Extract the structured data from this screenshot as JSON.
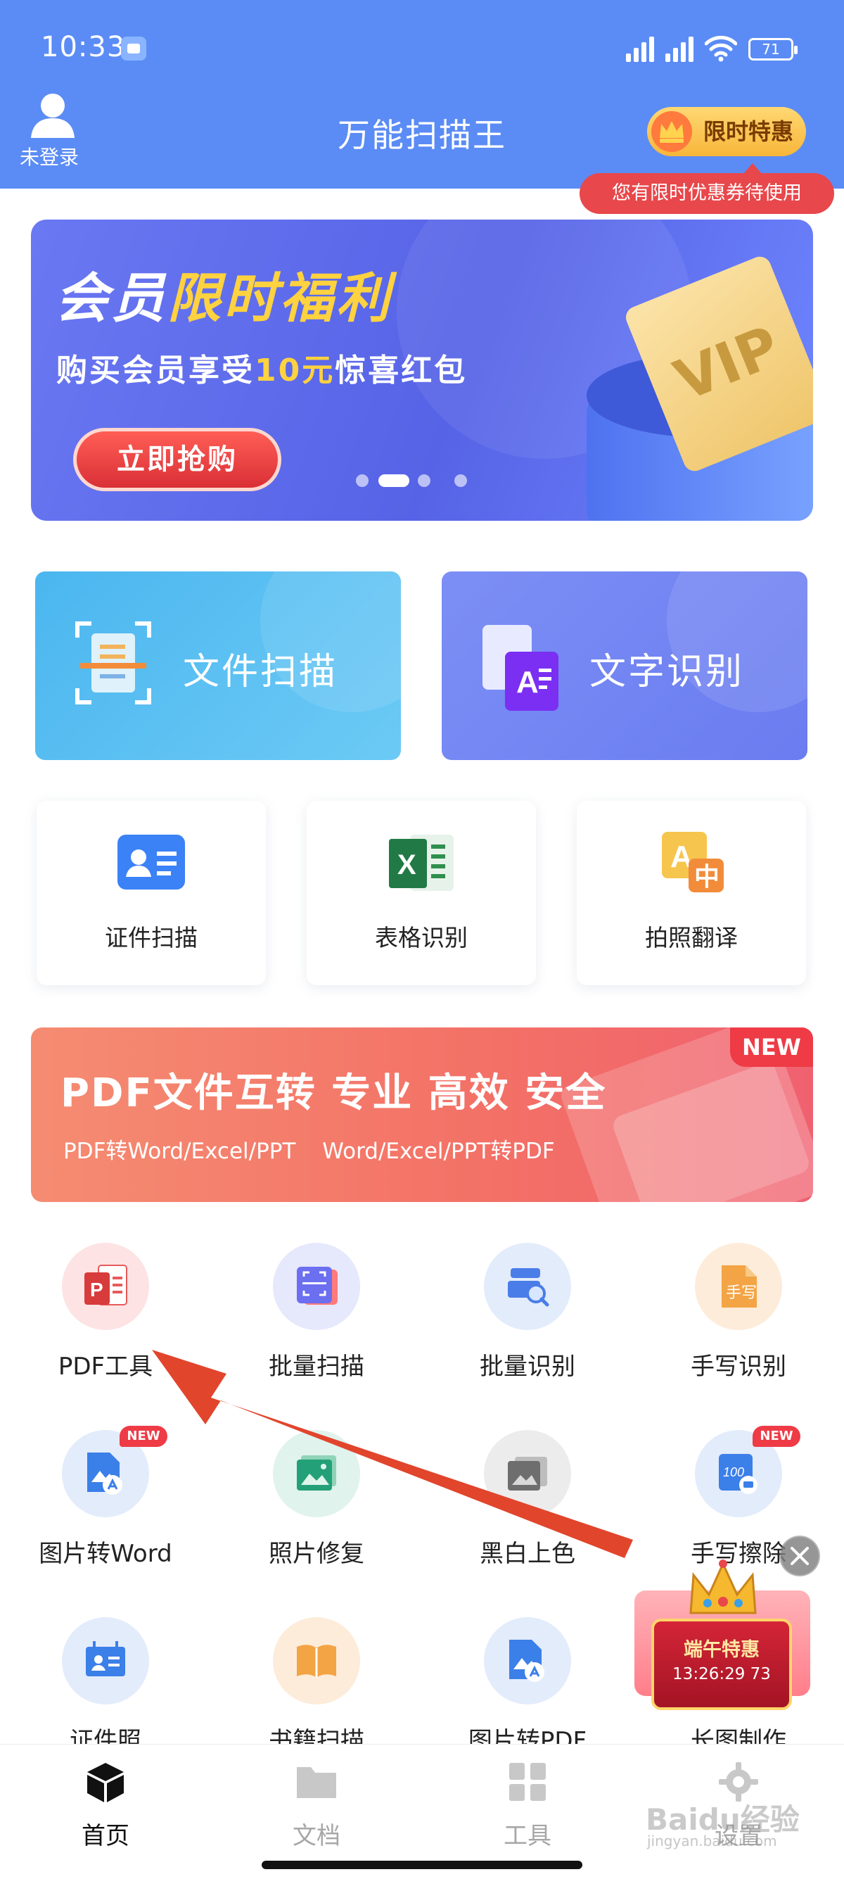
{
  "status_bar": {
    "time": "10:33",
    "battery": "71"
  },
  "header": {
    "login_label": "未登录",
    "title": "万能扫描王",
    "promo_label": "限时特惠",
    "promo_tip": "您有限时优惠券待使用"
  },
  "banner": {
    "title_prefix": "会员",
    "title_highlight": "限时福利",
    "subtitle_prefix": "购买会员享受",
    "subtitle_highlight": "10元",
    "subtitle_suffix": "惊喜红包",
    "button": "立即抢购",
    "card_text": "VIP",
    "pages": 4,
    "active_page": 2
  },
  "feature_cards": [
    {
      "label": "文件扫描",
      "icon": "document-scan-icon"
    },
    {
      "label": "文字识别",
      "icon": "text-recognition-icon"
    }
  ],
  "small_cards": [
    {
      "label": "证件扫描",
      "icon": "id-card-icon"
    },
    {
      "label": "表格识别",
      "icon": "excel-icon"
    },
    {
      "label": "拍照翻译",
      "icon": "translate-icon"
    }
  ],
  "pdf_banner": {
    "title": "PDF文件互转 专业 高效 安全",
    "subtitle_left": "PDF转Word/Excel/PPT",
    "subtitle_right": "Word/Excel/PPT转PDF",
    "badge": "NEW"
  },
  "tools": [
    {
      "label": "PDF工具",
      "icon": "pdf-icon"
    },
    {
      "label": "批量扫描",
      "icon": "batch-scan-icon"
    },
    {
      "label": "批量识别",
      "icon": "batch-recognize-icon"
    },
    {
      "label": "手写识别",
      "icon": "handwriting-icon"
    },
    {
      "label": "图片转Word",
      "icon": "image-to-word-icon",
      "badge": "NEW"
    },
    {
      "label": "照片修复",
      "icon": "photo-repair-icon"
    },
    {
      "label": "黑白上色",
      "icon": "colorize-icon"
    },
    {
      "label": "手写擦除",
      "icon": "handwriting-erase-icon",
      "badge": "NEW"
    },
    {
      "label": "证件照",
      "icon": "id-photo-icon"
    },
    {
      "label": "书籍扫描",
      "icon": "book-scan-icon"
    },
    {
      "label": "图片转PDF",
      "icon": "image-to-pdf-icon"
    },
    {
      "label": "长图制作",
      "icon": "long-image-icon"
    }
  ],
  "floating_promo": {
    "title": "端午特惠",
    "countdown": "13:26:29 73"
  },
  "bottom_nav": [
    {
      "label": "首页",
      "icon": "home-cube-icon",
      "active": true
    },
    {
      "label": "文档",
      "icon": "folder-icon",
      "active": false
    },
    {
      "label": "工具",
      "icon": "grid-icon",
      "active": false
    },
    {
      "label": "设置",
      "icon": "settings-gear-icon",
      "active": false
    }
  ],
  "watermark": {
    "text": "Baidu经验",
    "url": "jingyan.baidu.com"
  },
  "colors": {
    "header": "#5b8cf5",
    "accent_red": "#ee3b46",
    "banner_blue": "#5663e6"
  }
}
